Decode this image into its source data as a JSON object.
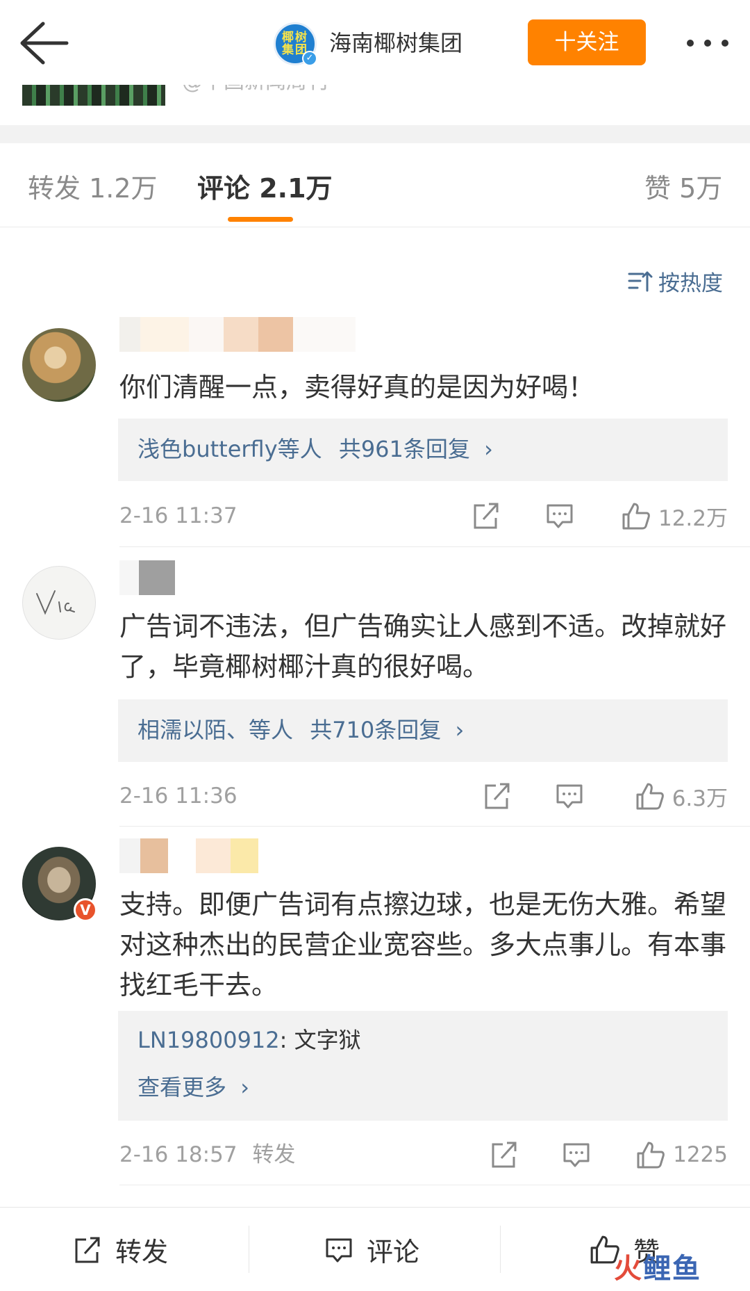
{
  "header": {
    "brand_logo_text": "椰树集团",
    "account_name": "海南椰树集团",
    "follow_label": "十关注",
    "partial_source_text": "@中国新闻周刊"
  },
  "tabs": [
    {
      "label": "转发 1.2万"
    },
    {
      "label": "评论 2.1万"
    },
    {
      "label": "赞 5万"
    }
  ],
  "sort_label": "按热度",
  "comments": [
    {
      "text": "你们清醒一点，卖得好真的是因为好喝！",
      "reply_names": "浅色butterfly等人",
      "reply_count": "共961条回复",
      "time": "2-16 11:37",
      "likes": "12.2万"
    },
    {
      "text": "广告词不违法，但广告确实让人感到不适。改掉就好了，毕竟椰树椰汁真的很好喝。",
      "reply_names": "相濡以陌、等人",
      "reply_count": "共710条回复",
      "time": "2-16 11:36",
      "likes": "6.3万"
    },
    {
      "text": "支持。即便广告词有点擦边球，也是无伤大雅。希望对这种杰出的民营企业宽容些。多大点事儿。有本事找红毛干去。",
      "reply_user": "LN19800912",
      "reply_text": ": 文字狱",
      "see_more": "查看更多",
      "time": "2-16 18:57",
      "repost_tag": "转发",
      "likes": "1225"
    }
  ],
  "bottom_bar": {
    "repost": "转发",
    "comment": "评论",
    "like": "赞"
  },
  "watermark": {
    "part1": "火",
    "part2": "鲤鱼"
  },
  "colors": {
    "accent_orange": "#ff8200",
    "link_blue": "#4a6d92",
    "reply_bg": "#f2f2f2",
    "text_main": "#333333",
    "text_meta": "#a0a0a0"
  },
  "icons": [
    "back-arrow-icon",
    "more-dots-icon",
    "sort-icon",
    "share-icon",
    "comment-icon",
    "like-icon",
    "verified-icon"
  ]
}
